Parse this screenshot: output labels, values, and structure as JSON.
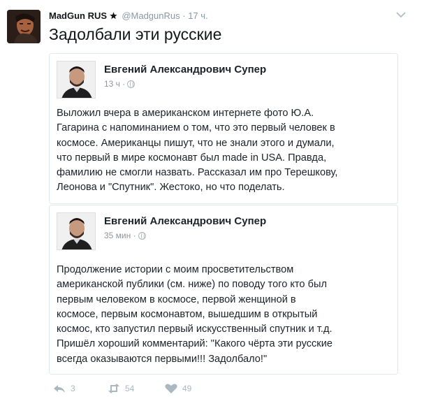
{
  "header": {
    "display_name": "MadGun RUS",
    "handle": "@MadgunRus",
    "separator": "·",
    "time": "17 ч."
  },
  "tweet_text": "Задолбали эти русские",
  "quotes": [
    {
      "author": "Евгений Александрович Супер",
      "time": "13 ч ·",
      "lines": [
        "Выложил вчера в американском интернете фото Ю.А.",
        "Гагарина с напоминанием о том, что это первый человек в",
        "космосе. Американцы пишут, что не знали этого и думали,",
        "что первый в мире космонавт был made in USA. Правда,",
        "фамилию не смогли назвать. Рассказал им про Терешкову,",
        "Леонова и \"Спутник\". Жестоко, но что поделать."
      ]
    },
    {
      "author": "Евгений Александрович Супер",
      "time": "35 мин ·",
      "lines": [
        "Продолжение истории с моим просветительством",
        "американской публики (см. ниже) по поводу того кто был",
        "первым человеком в космосе, первой женщиной в",
        "космосе, первым космонавтом, вышедшим в открытый",
        "космос, кто запустил первый искусственный спутник и т.д.",
        "Пришёл хороший комментарий: \"Какого чёрта эти русские",
        "всегда оказываются первыми!!! Задолбало!\""
      ]
    }
  ],
  "actions": {
    "replies": "3",
    "retweets": "54",
    "likes": "49"
  },
  "colors": {
    "muted": "#8899a6",
    "action_icons": "#aab8c2",
    "border": "#e1e8ed"
  }
}
